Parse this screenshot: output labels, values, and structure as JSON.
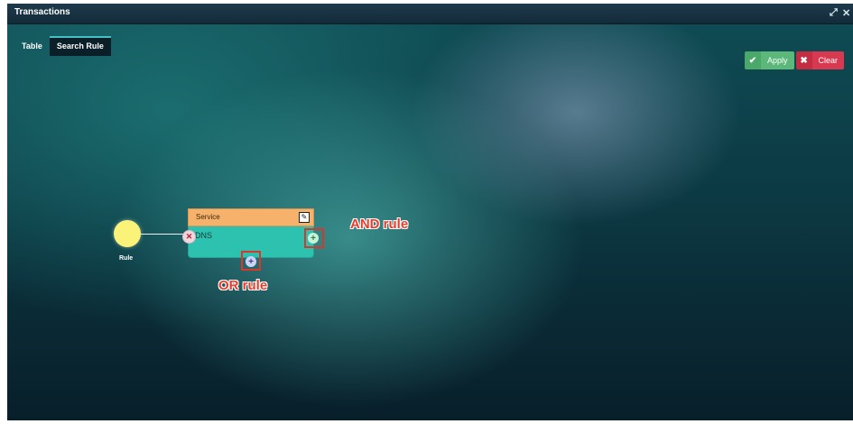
{
  "window": {
    "title": "Transactions",
    "controls": [
      "⤢",
      "✕"
    ]
  },
  "tabs": [
    {
      "label": "Table"
    },
    {
      "label": "Search Rule"
    }
  ],
  "actions": {
    "apply_label": "Apply",
    "clear_label": "Clear"
  },
  "rule": {
    "root_label": "Rule"
  },
  "condition": {
    "field": "Service",
    "value": "DNS"
  },
  "annotations": {
    "and_rule": "AND rule",
    "or_rule": "OR rule"
  },
  "colors": {
    "accent": "#46c0c4",
    "apply": "#5cb87a",
    "clear": "#d93950",
    "card_header": "#f6b26b",
    "card_body": "#2dc2b0",
    "rule_node": "#fbf27a",
    "annotation": "#ee3b2a"
  }
}
